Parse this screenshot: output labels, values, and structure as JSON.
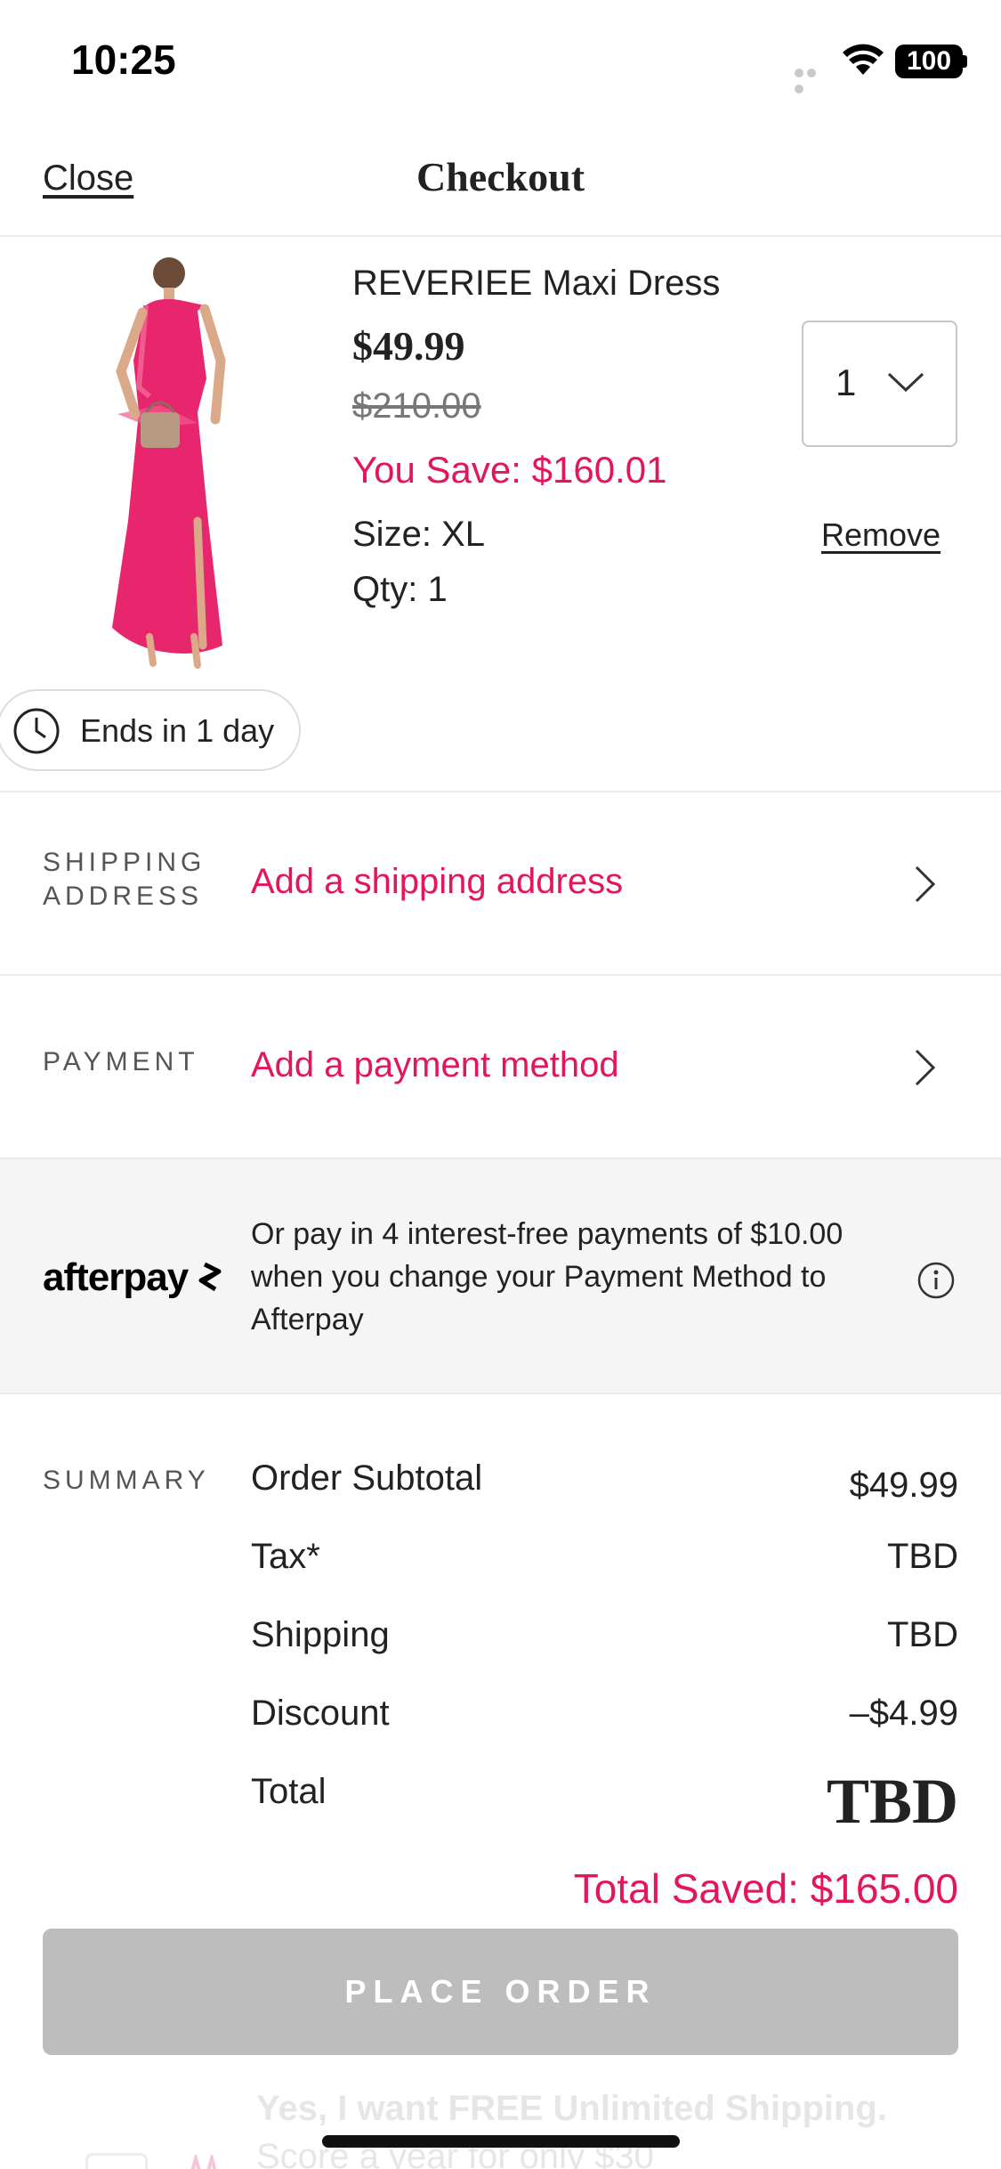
{
  "status_bar": {
    "time": "10:25",
    "battery": "100"
  },
  "nav": {
    "close_label": "Close",
    "title": "Checkout"
  },
  "product": {
    "name": "REVERIEE Maxi Dress",
    "price": "$49.99",
    "original_price": "$210.00",
    "you_save": "You Save: $160.01",
    "size": "Size: XL",
    "qty": "Qty: 1",
    "qty_select_value": "1",
    "remove_label": "Remove",
    "ends_label": "Ends in 1 day",
    "colors": {
      "dress": "#e8266d",
      "accent": "#e3165b"
    }
  },
  "shipping": {
    "label_line1": "SHIPPING",
    "label_line2": "ADDRESS",
    "action": "Add a shipping address"
  },
  "payment": {
    "label": "PAYMENT",
    "action": "Add a payment method"
  },
  "afterpay": {
    "logo": "afterpay",
    "message": "Or pay in 4 interest-free payments of $10.00 when you change your Payment Method to Afterpay"
  },
  "summary": {
    "label": "SUMMARY",
    "rows": [
      {
        "label": "Order Subtotal",
        "value": "$49.99"
      },
      {
        "label": "Tax*",
        "value": "TBD"
      },
      {
        "label": "Shipping",
        "value": "TBD"
      },
      {
        "label": "Discount",
        "value": "–$4.99"
      }
    ],
    "total_label": "Total",
    "total_value": "TBD",
    "total_saved": "Total Saved: $165.00"
  },
  "place_order_label": "PLACE ORDER",
  "promo": {
    "line1": "Yes, I want FREE Unlimited Shipping.",
    "line2": "Score a year for only $30"
  }
}
